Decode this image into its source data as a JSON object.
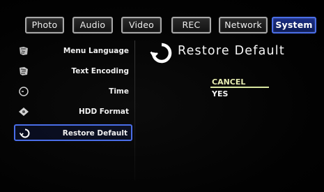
{
  "tabs": [
    {
      "label": "Photo"
    },
    {
      "label": "Audio"
    },
    {
      "label": "Video"
    },
    {
      "label": "REC"
    },
    {
      "label": "Network"
    },
    {
      "label": "System"
    }
  ],
  "active_tab": "System",
  "sidebar": {
    "items": [
      {
        "label": "Menu Language",
        "icon": "language-icon"
      },
      {
        "label": "Text Encoding",
        "icon": "text-encoding-icon"
      },
      {
        "label": "Time",
        "icon": "clock-icon"
      },
      {
        "label": "HDD Format",
        "icon": "hdd-format-icon"
      },
      {
        "label": "Restore Default",
        "icon": "restore-icon"
      }
    ],
    "selected": "Restore Default"
  },
  "panel": {
    "title": "Restore Default",
    "options": [
      {
        "label": "CANCEL"
      },
      {
        "label": "YES"
      }
    ],
    "highlighted_option": "CANCEL"
  },
  "colors": {
    "accent_blue": "#4a6ee8",
    "highlight_underline": "#d9e6a0",
    "background": "#000000",
    "text": "#f0f0f0"
  }
}
